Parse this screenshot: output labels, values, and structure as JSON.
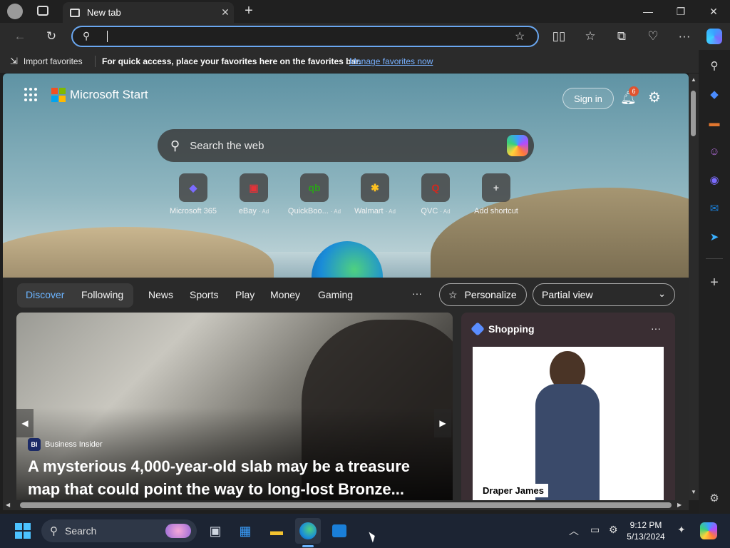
{
  "browser": {
    "tab_title": "New tab",
    "address_value": "",
    "favbar": {
      "import_label": "Import favorites",
      "hint": "For quick access, place your favorites here on the favorites bar.",
      "manage_link": "Manage favorites now"
    }
  },
  "page": {
    "brand": "Microsoft Start",
    "sign_in": "Sign in",
    "notification_count": "6",
    "search_placeholder": "Search the web",
    "shortcuts": [
      {
        "label": "Microsoft 365",
        "ad": "",
        "glyph": "◆",
        "color": "#7b6bff"
      },
      {
        "label": "eBay",
        "ad": "· Ad",
        "glyph": "▣",
        "color": "#e53238"
      },
      {
        "label": "QuickBoo...",
        "ad": "· Ad",
        "glyph": "qb",
        "color": "#2ca01c"
      },
      {
        "label": "Walmart",
        "ad": "· Ad",
        "glyph": "✱",
        "color": "#ffc220"
      },
      {
        "label": "QVC",
        "ad": "· Ad",
        "glyph": "Q",
        "color": "#d9261c"
      },
      {
        "label": "Add shortcut",
        "ad": "",
        "glyph": "+",
        "color": "#dddddd"
      }
    ],
    "feed_nav": {
      "discover": "Discover",
      "following": "Following",
      "items": [
        "News",
        "Sports",
        "Play",
        "Money",
        "Gaming"
      ],
      "more": "···",
      "personalize": "Personalize",
      "view_select": "Partial view"
    },
    "hero": {
      "source": "Business Insider",
      "source_abbr": "BI",
      "headline": "A mysterious 4,000-year-old slab may be a treasure map that could point the way to long-lost Bronze..."
    },
    "shopping": {
      "title": "Shopping",
      "more": "···",
      "product_label": "Draper James"
    }
  },
  "taskbar": {
    "search_label": "Search",
    "time": "9:12 PM",
    "date": "5/13/2024"
  },
  "colors": {
    "accent": "#6aa7f0",
    "link": "#77b0ff",
    "active_nav": "#6cb4ff",
    "badge": "#e0532f"
  }
}
